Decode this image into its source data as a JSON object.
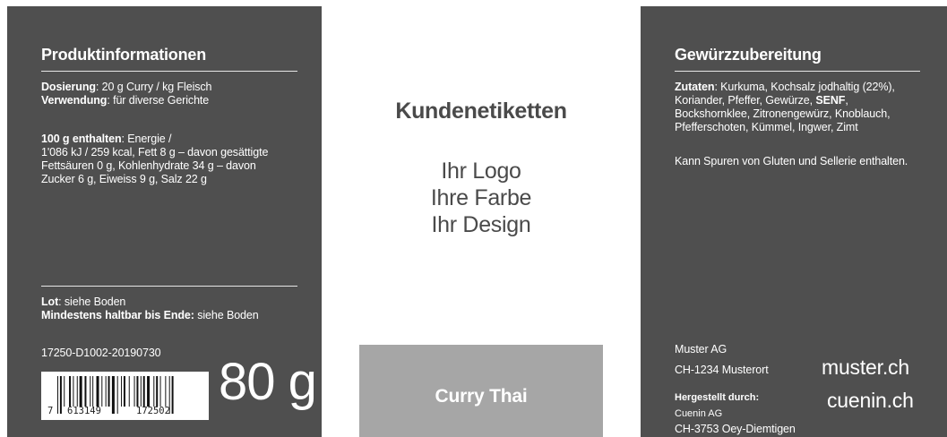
{
  "left": {
    "title": "Produktinformationen",
    "dosage_label": "Dosierung",
    "dosage_value": ": 20 g Curry / kg Fleisch",
    "usage_label": "Verwendung",
    "usage_value": ": für diverse Gerichte",
    "nutrition_label": "100 g enthalten",
    "nutrition_line1": ": Energie /",
    "nutrition_line2": "1'086 kJ / 259 kcal, Fett 8 g – davon gesättigte",
    "nutrition_line3": "Fettsäuren 0 g, Kohlenhydrate 34 g – davon",
    "nutrition_line4": "Zucker 6 g, Eiweiss 9 g, Salz 22 g",
    "lot_label": "Lot",
    "lot_value": ": siehe Boden",
    "bbd_label": "Mindestens haltbar bis Ende:",
    "bbd_value": " siehe Boden",
    "lot_code": "17250-D1002-20190730",
    "barcode_digit_first": "7",
    "barcode_digits_left": "613149",
    "barcode_digits_right": "172502",
    "weight": "80 g"
  },
  "center": {
    "title": "Kundenetiketten",
    "line1": "Ihr Logo",
    "line2": "Ihre Farbe",
    "line3": "Ihr Design",
    "product_name": "Curry Thai"
  },
  "right": {
    "title": "Gewürzzubereitung",
    "ingredients_label": "Zutaten",
    "ingredients_line1": ": Kurkuma, Kochsalz jodhaltig (22%),",
    "ingredients_line2a": "Koriander, Pfeffer, Gewürze, ",
    "allergen": "SENF",
    "ingredients_line2b": ",",
    "ingredients_line3": "Bockshornklee, Zitronengewürz, Knoblauch,",
    "ingredients_line4": "Pfefferschoten, Kümmel, Ingwer, Zimt",
    "traces": "Kann Spuren von Gluten und Sellerie enthalten.",
    "company_name": "Muster AG",
    "company_city": "CH-1234 Musterort",
    "company_url": "muster.ch",
    "made_by_label": "Hergestellt durch:",
    "maker_name": "Cuenin AG",
    "maker_city": "CH-3753 Oey-Diemtigen",
    "maker_url": "cuenin.ch"
  },
  "colors": {
    "panel": "#4f4f4f",
    "product_box": "#a6a6a6",
    "center_text": "#4a4a4a"
  }
}
